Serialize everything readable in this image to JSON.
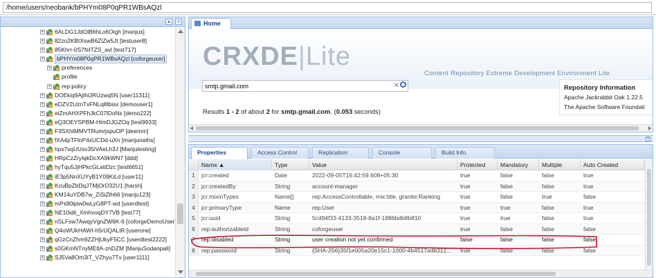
{
  "path": "/home/users/neobank/bPHYm08P0qPR1WBsAQzl",
  "tree": {
    "expand_all_icon": "tree-icon",
    "collapse_icon": "double-chevron-left-icon",
    "items": [
      {
        "label": "6ALDG1JdOlB6hLo6Oigh [manjus]",
        "level": 0,
        "type": "node"
      },
      {
        "label": "82zo2KBtXswB6ZiZw5Jt [testuser8]",
        "level": 0,
        "type": "node"
      },
      {
        "label": "85Khrr-0S7fsITZS_avl [test717]",
        "level": 0,
        "type": "node"
      },
      {
        "label": "bPHYm08P0qPR1WBsAQzl [coforgeuser]",
        "level": 0,
        "type": "node",
        "selected": true
      },
      {
        "label": "preferences",
        "level": 1,
        "type": "node"
      },
      {
        "label": "profile",
        "level": 1,
        "type": "leaf"
      },
      {
        "label": "rep:policy",
        "level": 1,
        "type": "node"
      },
      {
        "label": "DOEkiq9AjIhlJRUzwq5N [user11311]",
        "level": 0,
        "type": "node"
      },
      {
        "label": "eDZV2UznTxFNLq8tbisx [demouser1]",
        "level": 0,
        "type": "node"
      },
      {
        "label": "eiZmAHXPFhJkC07lDoNs [demo222]",
        "level": 0,
        "type": "node"
      },
      {
        "label": "eQ3OEYSPBM-HlmDJGZOq [test9933]",
        "level": 0,
        "type": "node"
      },
      {
        "label": "F3SXhtMMVTRumrjspuOP [deemm]",
        "level": 0,
        "type": "node"
      },
      {
        "label": "fXA4pTFlnP4xUCDd-uXn [manjunaths]",
        "level": 0,
        "type": "node"
      },
      {
        "label": "hps7sqUUsv35iVAeLh3J [Manjutesting]",
        "level": 0,
        "type": "node"
      },
      {
        "label": "HRpCzZryIqkDcXA9kWN7 [ddd]",
        "level": 0,
        "type": "node"
      },
      {
        "label": "hyTqu5JjHPkcGLatiDzc [test6651]",
        "level": 0,
        "type": "node"
      },
      {
        "label": "iE3p5NnXUYyB1Y09KiLd [user11]",
        "level": 0,
        "type": "node"
      },
      {
        "label": "KcuBpZbDqJTMjOrD32U1 [harsh]",
        "level": 0,
        "type": "node"
      },
      {
        "label": "KM14uYDB7w_ZiSiZlh66 [manju123]",
        "level": 0,
        "type": "node"
      },
      {
        "label": "mPs90lpiw0wLyG8PT-wd [userdtest]",
        "level": 0,
        "type": "node"
      },
      {
        "label": "NE10idli_XmhvoqDY7VB [test77]",
        "level": 0,
        "type": "node"
      },
      {
        "label": "nSLFsw7AwqyVgnZW6K-6 [coforgeDemoUser]",
        "level": 0,
        "type": "node"
      },
      {
        "label": "Q4oWUkHAWI-h5rUQALtR [userone]",
        "level": 0,
        "type": "node"
      },
      {
        "label": "qGzCnZhm9ZZHjUkyF5CC [userdtest2222]",
        "level": 0,
        "type": "node"
      },
      {
        "label": "s0GKmNTnyMEltA-znDZM [ManjuSodanpali]",
        "level": 0,
        "type": "node"
      },
      {
        "label": "SJ5Va8Om3iT_VZhyu7Tv [user1111]",
        "level": 0,
        "type": "node"
      }
    ]
  },
  "home_tab": {
    "label": "Home",
    "icon": "home-icon"
  },
  "banner": {
    "logo_crx": "CRXDE",
    "logo_sep": "|",
    "logo_lite": "Lite",
    "tagline": "Content Repository Extreme Development Environment Lite"
  },
  "search": {
    "value": "smtp.gmail.com",
    "clear_icon": "clear-x-icon",
    "go_icon": "search-icon"
  },
  "results": {
    "prefix": "Results ",
    "range": "1 - 2",
    "middle": " of about ",
    "count": "2",
    "for": " for ",
    "query": "smtp.gmail.com",
    "time_open": ". (",
    "time": "0.053",
    "time_close": " seconds)"
  },
  "repo_info": {
    "title": "Repository Information",
    "line1": "Apache Jackrabbit Oak 1.22.5",
    "line2": "The Apache Software Foundati"
  },
  "prop_tabs": [
    "Properties",
    "Access Control",
    "Replication",
    "Console",
    "Build Info"
  ],
  "grid": {
    "columns": [
      "",
      "Name ▲",
      "Type",
      "Value",
      "Protected",
      "Mandatory",
      "Multiple",
      "Auto Created"
    ],
    "rows": [
      {
        "n": "1",
        "name": "jcr:created",
        "type": "Date",
        "value": "2022-09-05T16:42:59.608+05:30",
        "protected": "true",
        "mandatory": "false",
        "multiple": "false",
        "auto": "true"
      },
      {
        "n": "2",
        "name": "jcr:createdBy",
        "type": "String",
        "value": "account-manager",
        "protected": "true",
        "mandatory": "false",
        "multiple": "false",
        "auto": "true"
      },
      {
        "n": "3",
        "name": "jcr:mixinTypes",
        "type": "Name[]",
        "value": "rep:AccessControllable, mix:title, granite:Ranking",
        "protected": "true",
        "mandatory": "false",
        "multiple": "true",
        "auto": "false"
      },
      {
        "n": "4",
        "name": "jcr:primaryType",
        "type": "Name",
        "value": "rep:User",
        "protected": "true",
        "mandatory": "true",
        "multiple": "false",
        "auto": "true"
      },
      {
        "n": "5",
        "name": "jcr:uuid",
        "type": "String",
        "value": "5cd94f33-4133-3518-8a1f-1886bdb8b810",
        "protected": "true",
        "mandatory": "true",
        "multiple": "false",
        "auto": "true"
      },
      {
        "n": "6",
        "name": "rep:authorizableId",
        "type": "String",
        "value": "coforgeuser",
        "protected": "true",
        "mandatory": "false",
        "multiple": "false",
        "auto": "false"
      },
      {
        "n": "7",
        "name": "rep:disabled",
        "type": "String",
        "value": "user creation not yet confirmed",
        "protected": "false",
        "mandatory": "false",
        "multiple": "false",
        "auto": "false"
      },
      {
        "n": "8",
        "name": "rep:password",
        "type": "String",
        "value": "{SHA-256}35f1e005a20e15c1-1000-4b4517adb312...",
        "protected": "true",
        "mandatory": "false",
        "multiple": "false",
        "auto": "false"
      }
    ]
  },
  "colors": {
    "panel_border": "#99bbe8",
    "annotation": "#c8102e",
    "link_blue": "#15428b"
  }
}
